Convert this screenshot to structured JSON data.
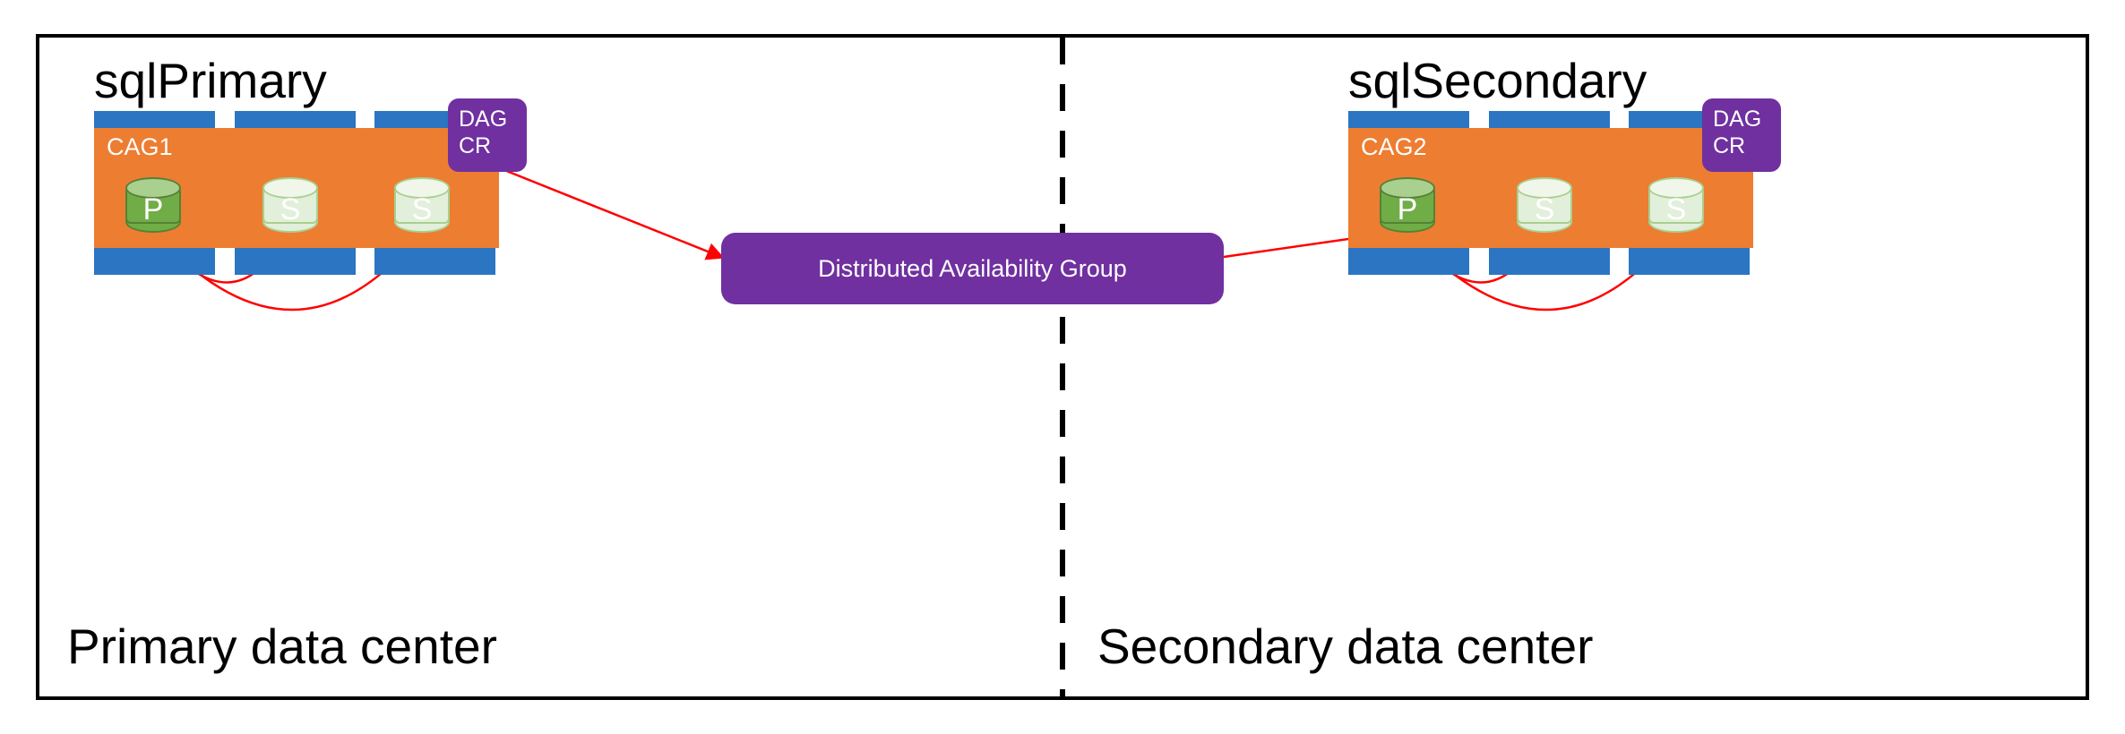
{
  "diagram": {
    "primary": {
      "title": "sqlPrimary",
      "rack_label": "CAG1",
      "dag_badge_line1": "DAG",
      "dag_badge_line2": "CR",
      "footer": "Primary data center"
    },
    "secondary": {
      "title": "sqlSecondary",
      "rack_label": "CAG2",
      "dag_badge_line1": "DAG",
      "dag_badge_line2": "CR",
      "footer": "Secondary data center"
    },
    "node_labels": {
      "primary": "P",
      "secondary": "S"
    },
    "center_box": "Distributed Availability Group"
  }
}
